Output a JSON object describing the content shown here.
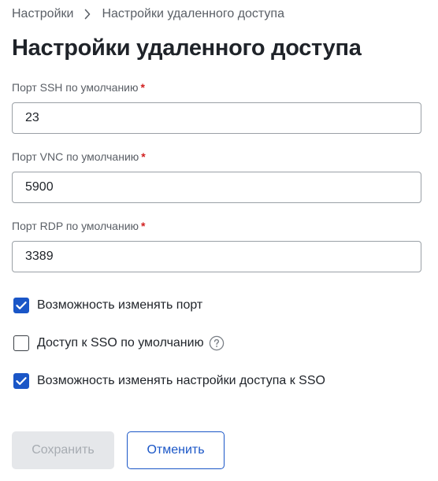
{
  "breadcrumb": {
    "parent": "Настройки",
    "current": "Настройки удаленного доступа"
  },
  "page": {
    "title": "Настройки удаленного доступа"
  },
  "fields": {
    "ssh": {
      "label": "Порт SSH по умолчанию",
      "required_mark": "*",
      "value": "23"
    },
    "vnc": {
      "label": "Порт VNC по умолчанию",
      "required_mark": "*",
      "value": "5900"
    },
    "rdp": {
      "label": "Порт RDP по умолчанию",
      "required_mark": "*",
      "value": "3389"
    }
  },
  "checkboxes": {
    "allow_port_change": {
      "label": "Возможность изменять порт",
      "checked": true
    },
    "sso_default": {
      "label": "Доступ к SSO по умолчанию",
      "checked": false,
      "has_help": true
    },
    "allow_sso_settings_change": {
      "label": "Возможность изменять настройки доступа к SSO",
      "checked": true
    }
  },
  "buttons": {
    "save_label": "Сохранить",
    "cancel_label": "Отменить"
  },
  "colors": {
    "accent": "#1a56c7",
    "required": "#d11f1f",
    "disabled_bg": "#e5e7ea",
    "disabled_text": "#a7acb2"
  },
  "icons": {
    "breadcrumb_separator": "chevron-right-icon",
    "check": "check-icon",
    "help": "question-circle-icon"
  }
}
